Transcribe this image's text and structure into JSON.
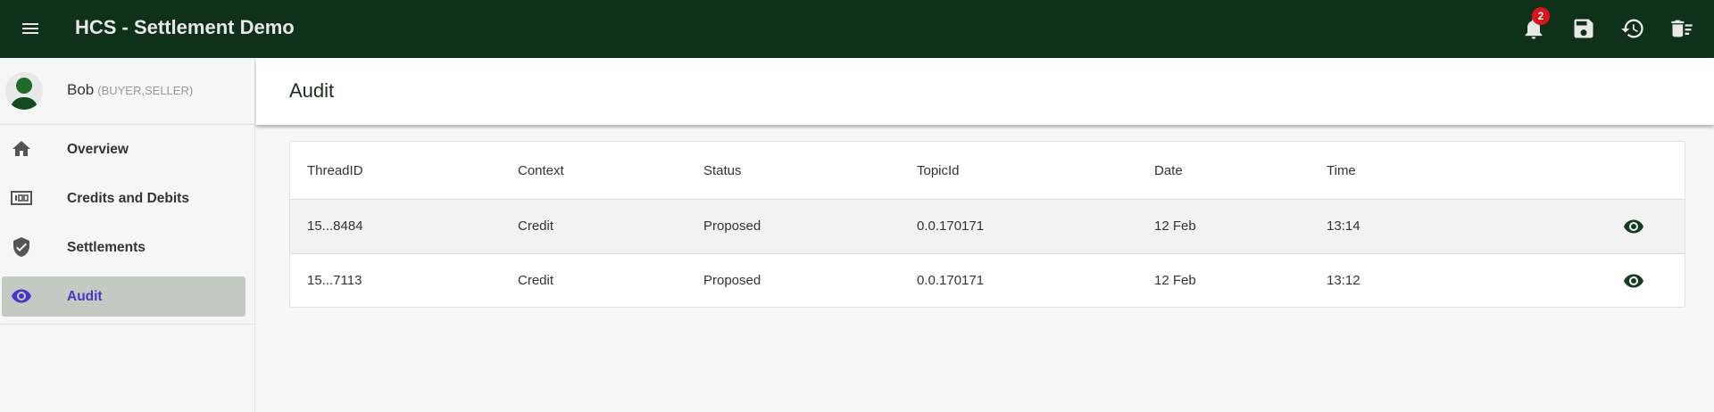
{
  "app": {
    "title": "HCS - Settlement Demo",
    "notification_count": "2"
  },
  "user": {
    "name": "Bob",
    "roles": "(BUYER,SELLER)"
  },
  "sidebar": {
    "items": [
      {
        "label": "Overview",
        "icon": "home-icon"
      },
      {
        "label": "Credits and Debits",
        "icon": "money-icon"
      },
      {
        "label": "Settlements",
        "icon": "verified-shield-icon"
      },
      {
        "label": "Audit",
        "icon": "eye-icon",
        "selected": true
      }
    ]
  },
  "page": {
    "title": "Audit"
  },
  "table": {
    "headers": [
      "ThreadID",
      "Context",
      "Status",
      "TopicId",
      "Date",
      "Time"
    ],
    "rows": [
      [
        "15...8484",
        "Credit",
        "Proposed",
        "0.0.170171",
        "12 Feb",
        "13:14"
      ],
      [
        "15...7113",
        "Credit",
        "Proposed",
        "0.0.170171",
        "12 Feb",
        "13:12"
      ]
    ]
  },
  "colors": {
    "topbar": "#0f3019",
    "accent": "#4a35c9",
    "badge": "#d9141c",
    "selected_bg": "#c1cbc1"
  }
}
